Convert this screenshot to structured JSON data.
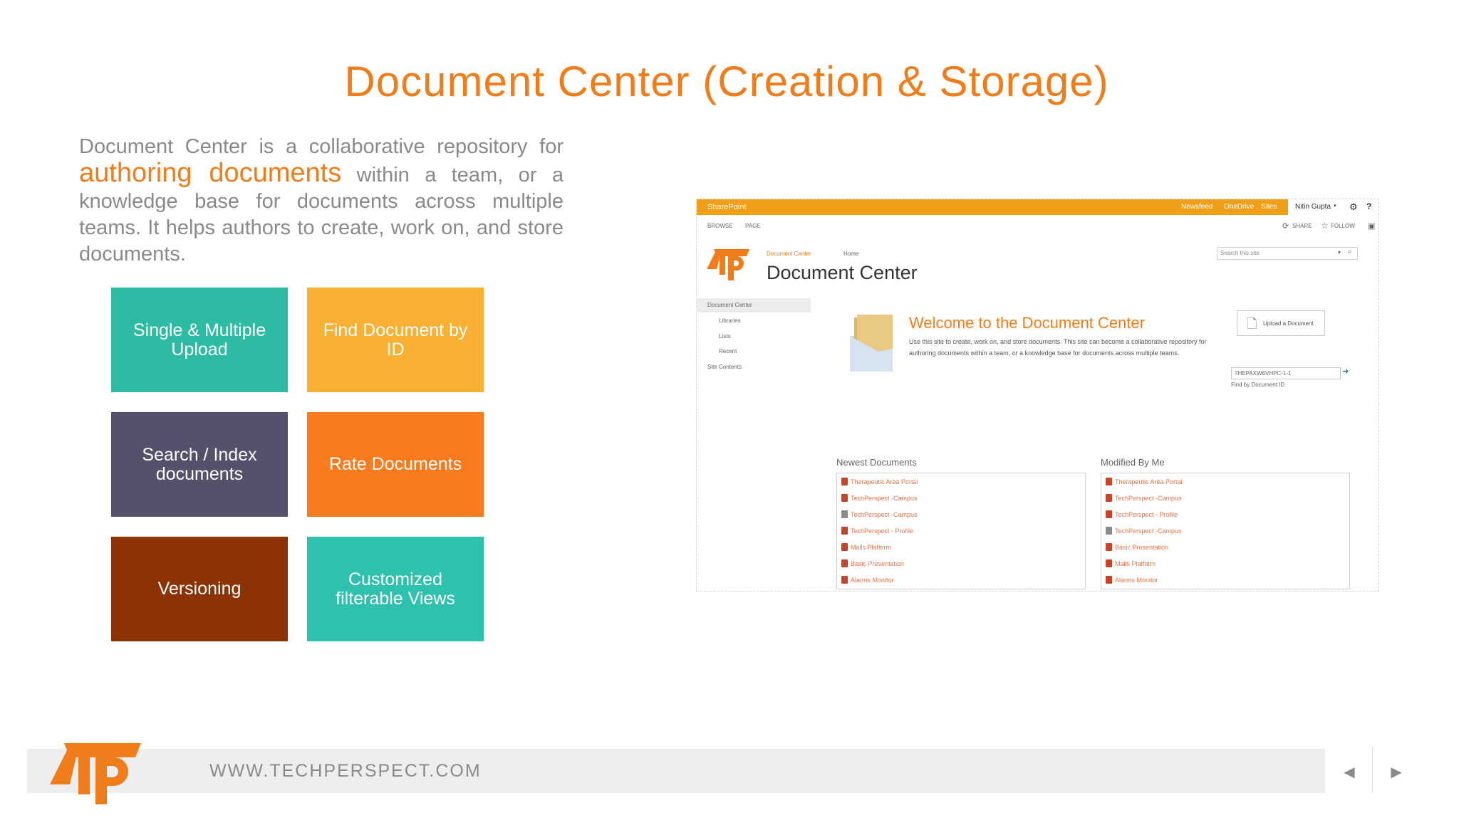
{
  "slide": {
    "title": "Document Center (Creation & Storage)",
    "intro_before": "Document Center is a collaborative repository for ",
    "intro_highlight": "authoring documents",
    "intro_after": " within a team, or a knowledge base for documents across multiple teams. It helps authors to create, work on, and store documents."
  },
  "tiles": [
    {
      "label": "Single & Multiple Upload",
      "color": "#2dbba4"
    },
    {
      "label": "Find Document by ID",
      "color": "#f8b133"
    },
    {
      "label": "Search / Index documents",
      "color": "#57506b"
    },
    {
      "label": "Rate Documents",
      "color": "#f97b1e"
    },
    {
      "label": "Versioning",
      "color": "#8c3305"
    },
    {
      "label": "Customized filterable Views",
      "color": "#2ec2ae"
    }
  ],
  "sharepoint": {
    "brand": "SharePoint",
    "top_links": [
      "Newsfeed",
      "OneDrive",
      "Sites"
    ],
    "user": "Nitin Gupta",
    "ribbon_tabs": [
      "BROWSE",
      "PAGE"
    ],
    "share": "SHARE",
    "follow": "FOLLOW",
    "breadcrumb_1": "Document Center",
    "breadcrumb_2": "Home",
    "site_title": "Document Center",
    "search_placeholder": "Search this site",
    "nav": [
      "Document Center",
      "Libraries",
      "Lists",
      "Recent",
      "Site Contents"
    ],
    "welcome_title": "Welcome to the Document Center",
    "welcome_desc": "Use this site to create, work on, and store documents. This site can become a collaborative repository for authoring documents within a team, or a knowledge base for documents across multiple teams.",
    "upload_label": "Upload a Document",
    "doc_id_value": "7HEPAXW6VHPC-1-1",
    "find_label": "Find by Document ID",
    "newest_heading": "Newest Documents",
    "newest_items": [
      "Therapeutic Area Portal",
      "TechPerspect -Campus",
      "TechPerspect -Campus",
      "TechPerspect - Profile",
      "Malls Platform",
      "Basic Presentation",
      "Alarms Monitor"
    ],
    "modified_heading": "Modified By Me",
    "modified_items": [
      "Therapeutic Area Portal",
      "TechPerspect -Campus",
      "TechPerspect - Profile",
      "TechPerspect -Campus",
      "Basic Presentation",
      "Malls Platform",
      "Alarms Monitor"
    ]
  },
  "footer": {
    "url": "WWW.TECHPERSPECT.COM",
    "prev_icon": "left-triangle",
    "next_icon": "right-triangle"
  },
  "colors": {
    "accent": "#f07d1a",
    "sharepoint_bar": "#f0a018",
    "text_gray": "#8a8a8a"
  }
}
